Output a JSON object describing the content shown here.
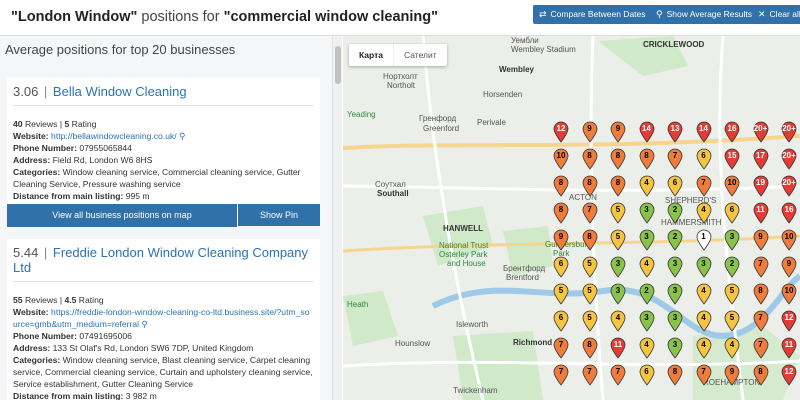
{
  "header": {
    "title_part1": "\"London Window\"",
    "title_part2": " positions for ",
    "title_part3": "\"commercial window cleaning\"",
    "buttons": [
      {
        "label": "Compare Between Dates",
        "icon": "swap-icon"
      },
      {
        "label": "Show Average Results",
        "icon": "search-icon"
      },
      {
        "label": "Clear all",
        "icon": "clear-icon"
      }
    ]
  },
  "left": {
    "heading": "Average positions for top 20 businesses",
    "businesses": [
      {
        "score": "3.06",
        "name": "Bella Window Cleaning",
        "reviews": "40",
        "reviews_label": "Reviews",
        "rating": "5",
        "rating_label": "Rating",
        "website_label": "Website:",
        "website": "http://bellawindowcleaning.co.uk/",
        "phone_label": "Phone Number:",
        "phone": "07955065844",
        "address_label": "Address:",
        "address": "Field Rd, London W6 8HS",
        "categories_label": "Categories:",
        "categories": "Window cleaning service, Commercial cleaning service, Gutter Cleaning Service, Pressure washing service",
        "distance_label": "Distance from main listing:",
        "distance": "995 m",
        "view_all_label": "View all business positions on map",
        "show_pin_label": "Show Pin"
      },
      {
        "score": "5.44",
        "name": "Freddie London Window Cleaning Company Ltd",
        "reviews": "55",
        "reviews_label": "Reviews",
        "rating": "4.5",
        "rating_label": "Rating",
        "website_label": "Website:",
        "website": "https://freddie-london-window-cleaning-co-ltd.business.site/?utm_source=gmb&utm_medium=referral",
        "phone_label": "Phone Number:",
        "phone": "07491695006",
        "address_label": "Address:",
        "address": "133 St Olaf's Rd, London SW6 7DP, United Kingdom",
        "categories_label": "Categories:",
        "categories": "Window cleaning service, Blast cleaning service, Carpet cleaning service, Commercial cleaning service, Curtain and upholstery cleaning service, Service establishment, Gutter Cleaning Service",
        "distance_label": "Distance from main listing:",
        "distance": "3 982 m",
        "view_all_label": "",
        "show_pin_label": ""
      }
    ]
  },
  "map": {
    "tabs": [
      {
        "label": "Карта",
        "active": true
      },
      {
        "label": "Сателит",
        "active": false
      }
    ],
    "labels": [
      "Уембли",
      "Wembley Stadium",
      "Wembley",
      "CRICKLEWOOD",
      "Нортхолт",
      "Northolt",
      "Horsenden",
      "Гренфорд",
      "Greenford",
      "Perivale",
      "Соутхал",
      "Southall",
      "HANWELL",
      "National Trust",
      "Osterley Park",
      "and House",
      "Брентфорд",
      "Brentford",
      "Gunnersbury",
      "Park",
      "Isleworth",
      "Hounslow",
      "Richmond",
      "Twickenham",
      "ACTON",
      "SHEPHERD'S",
      "HAMMERSMITH",
      "ROEHAMPTON",
      "Heath",
      "Yeading"
    ],
    "pin_grid": [
      [
        "12",
        "9",
        "9",
        "14",
        "13",
        "14",
        "16",
        "20+",
        "20+"
      ],
      [
        "10",
        "8",
        "8",
        "8",
        "7",
        "6",
        "15",
        "17",
        "20+"
      ],
      [
        "8",
        "8",
        "8",
        "4",
        "6",
        "7",
        "10",
        "19",
        "20+"
      ],
      [
        "8",
        "7",
        "5",
        "3",
        "2",
        "4",
        "6",
        "11",
        "16"
      ],
      [
        "9",
        "8",
        "5",
        "3",
        "2",
        "1",
        "3",
        "9",
        "10"
      ],
      [
        "6",
        "5",
        "3",
        "4",
        "3",
        "3",
        "2",
        "7",
        "9"
      ],
      [
        "5",
        "5",
        "3",
        "2",
        "3",
        "4",
        "5",
        "8",
        "10"
      ],
      [
        "6",
        "5",
        "4",
        "3",
        "3",
        "4",
        "5",
        "7",
        "12"
      ],
      [
        "7",
        "8",
        "11",
        "4",
        "3",
        "4",
        "4",
        "7",
        "11"
      ],
      [
        "7",
        "7",
        "7",
        "6",
        "8",
        "7",
        "9",
        "8",
        "12"
      ]
    ]
  }
}
